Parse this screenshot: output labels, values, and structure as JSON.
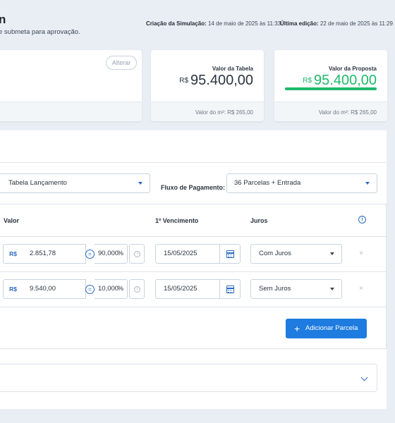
{
  "header": {
    "title_fragment": "n",
    "subtitle": "e submeta para aprovação.",
    "created_label": "Criação da Simulação:",
    "created_value": "14 de maio de 2025 às 11:33",
    "edited_label": "Última edição:",
    "edited_value": "22 de maio de 2025 às 11:29"
  },
  "cards": {
    "alterar_label": "Alterar",
    "tabela": {
      "label": "Valor da Tabela",
      "currency": "R$",
      "value": "95.400,00",
      "footer": "Valor do m²: R$ 265,00"
    },
    "proposta": {
      "label": "Valor da Proposta",
      "currency": "R$",
      "value": "95.400,00",
      "footer": "Valor do m²: R$ 265,00",
      "accent": "#1fb86a"
    }
  },
  "config": {
    "tabela_select": "Tabela Lançamento",
    "fluxo_label": "Fluxo de Pagamento:",
    "fluxo_select": "36 Parcelas + Entrada"
  },
  "table": {
    "headers": {
      "valor": "Valor",
      "vencimento": "1º Vencimento",
      "juros": "Juros"
    },
    "rows": [
      {
        "currency": "R$",
        "valor": "2.851,78",
        "eq": "=",
        "percent": "90,000",
        "percent_symbol": "%",
        "vencimento": "15/05/2025",
        "juros": "Com Juros",
        "remove": "×"
      },
      {
        "currency": "R$",
        "valor": "9.540,00",
        "eq": "=",
        "percent": "10,000",
        "percent_symbol": "%",
        "vencimento": "15/05/2025",
        "juros": "Sem Juros",
        "remove": "×"
      }
    ],
    "add_button": "Adicionar Parcela"
  },
  "colors": {
    "primary": "#1e7be0",
    "accent_green": "#1fb86a"
  }
}
